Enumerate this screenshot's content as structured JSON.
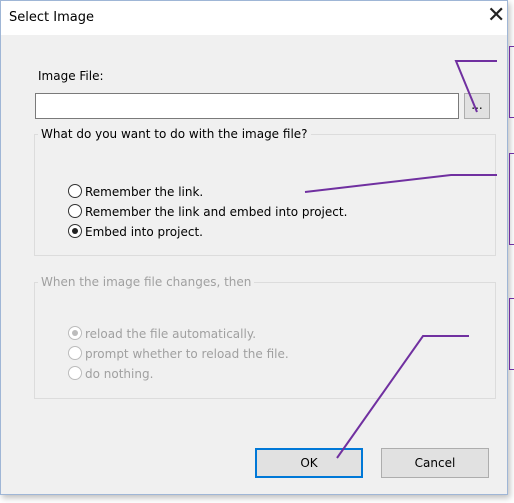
{
  "dialog": {
    "title": "Select Image",
    "close_glyph": "✕",
    "image_file_label": "Image File:",
    "image_file_value": "",
    "browse_label": "...",
    "group_action": {
      "legend": "What do you want to do with the image file?",
      "options": [
        {
          "label": "Remember the link.",
          "checked": false
        },
        {
          "label": "Remember the link and embed into project.",
          "checked": false
        },
        {
          "label": "Embed into project.",
          "checked": true
        }
      ]
    },
    "group_change": {
      "legend": "When the image file changes, then",
      "disabled": true,
      "options": [
        {
          "label": "reload the file automatically.",
          "checked": true
        },
        {
          "label": "prompt whether to reload the file.",
          "checked": false
        },
        {
          "label": "do nothing.",
          "checked": false
        }
      ]
    },
    "ok_label": "OK",
    "cancel_label": "Cancel"
  },
  "annotation_color": "#7030a0"
}
